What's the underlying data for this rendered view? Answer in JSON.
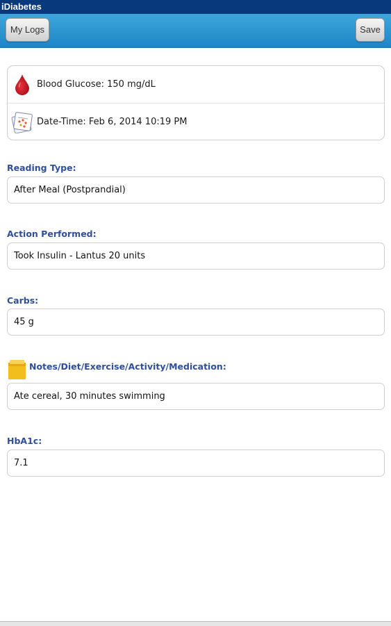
{
  "app": {
    "title": "iDiabetes"
  },
  "toolbar": {
    "my_logs_label": "My Logs",
    "save_label": "Save"
  },
  "summary": {
    "blood_glucose": "Blood Glucose: 150 mg/dL",
    "date_time": "Date-Time: Feb 6, 2014 10:19 PM",
    "blood_icon": "blood-drop-icon",
    "date_icon": "calendar-icon"
  },
  "form": {
    "reading_type": {
      "label": "Reading Type:",
      "value": "After Meal (Postprandial)"
    },
    "action": {
      "label": "Action Performed:",
      "value": "Took Insulin - Lantus 20 units"
    },
    "carbs": {
      "label": "Carbs:",
      "value": "45 g"
    },
    "notes": {
      "label": "Notes/Diet/Exercise/Activity/Medication:",
      "value": "Ate cereal, 30 minutes swimming",
      "icon": "sticky-note-icon"
    },
    "hba1c": {
      "label": "HbA1c:",
      "value": "7.1"
    }
  },
  "colors": {
    "title_bar": "#07397c",
    "toolbar": "#2796d3",
    "label": "#2f4f9b",
    "blood": "#c3121c",
    "note": "#f2be1d"
  }
}
